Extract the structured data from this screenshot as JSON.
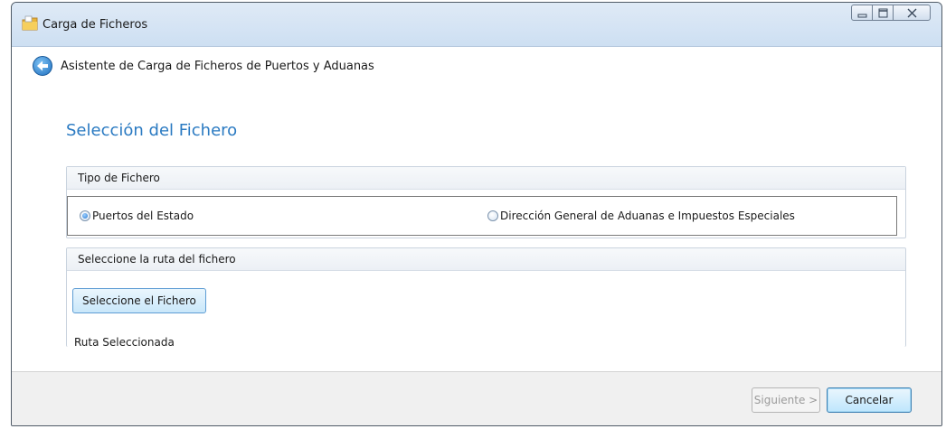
{
  "window": {
    "title": "Carga de Ficheros"
  },
  "nav": {
    "title": "Asistente de Carga de Ficheros de Puertos y Aduanas"
  },
  "page": {
    "title": "Selección del Fichero"
  },
  "file_type": {
    "header": "Tipo de Fichero",
    "options": [
      {
        "label": "Puertos del Estado",
        "checked": true
      },
      {
        "label": "Dirección General de Aduanas e Impuestos Especiales",
        "checked": false
      }
    ]
  },
  "file_path": {
    "header": "Seleccione la ruta del fichero",
    "button_label": "Seleccione el Fichero",
    "selected_label": "Ruta Seleccionada"
  },
  "footer": {
    "next_label": "Siguiente >",
    "cancel_label": "Cancelar"
  },
  "colors": {
    "accent": "#2a7ac2",
    "titlebar": "#cddff2"
  }
}
